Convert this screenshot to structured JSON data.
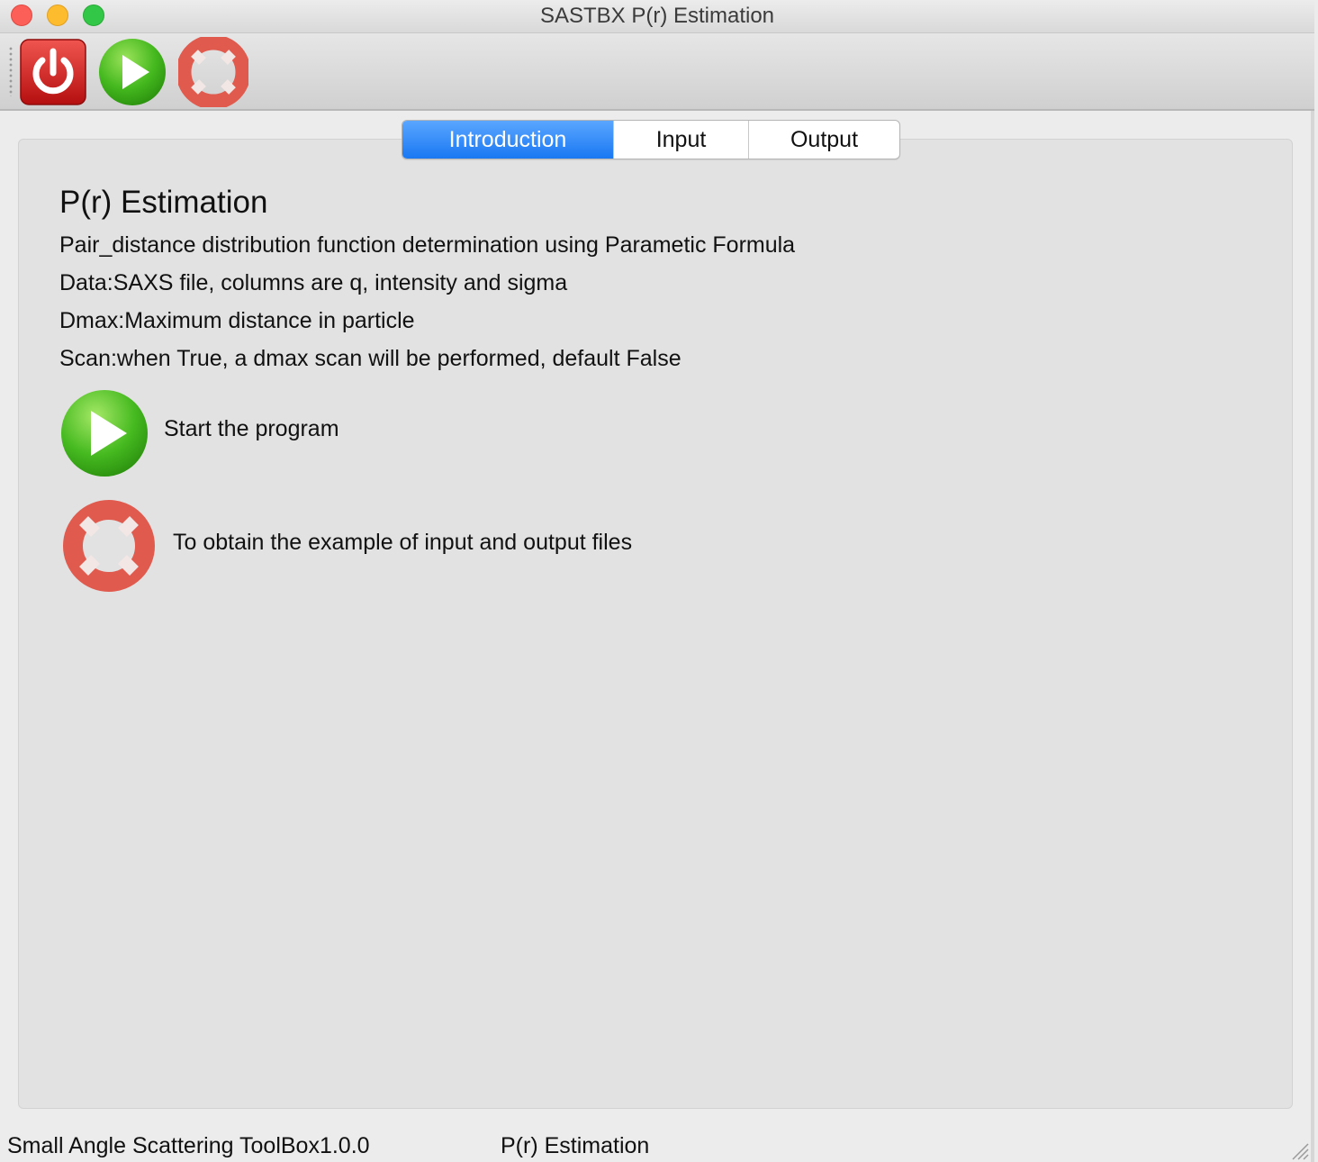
{
  "window": {
    "title": "SASTBX P(r) Estimation"
  },
  "toolbar": {
    "buttons": [
      {
        "icon": "power-icon",
        "color": "#e02828"
      },
      {
        "icon": "play-icon",
        "color": "#3fb51e"
      },
      {
        "icon": "lifebuoy-icon",
        "color": "#e05a4e"
      }
    ]
  },
  "tabs": [
    {
      "label": "Introduction",
      "active": true
    },
    {
      "label": "Input",
      "active": false
    },
    {
      "label": "Output",
      "active": false
    }
  ],
  "intro": {
    "title": "P(r) Estimation",
    "lines": [
      "Pair_distance distribution function determination using Parametic Formula",
      "Data:SAXS file, columns are q, intensity and sigma",
      "Dmax:Maximum distance in particle",
      "Scan:when True, a dmax scan will be performed, default False"
    ],
    "run_caption": "Start the program",
    "help_caption": "To obtain the example of  input and output files"
  },
  "statusbar": {
    "left": "Small Angle Scattering ToolBox1.0.0",
    "middle": "P(r) Estimation"
  },
  "colors": {
    "active_tab": "#1a78f2",
    "background": "#e2e2e2"
  }
}
